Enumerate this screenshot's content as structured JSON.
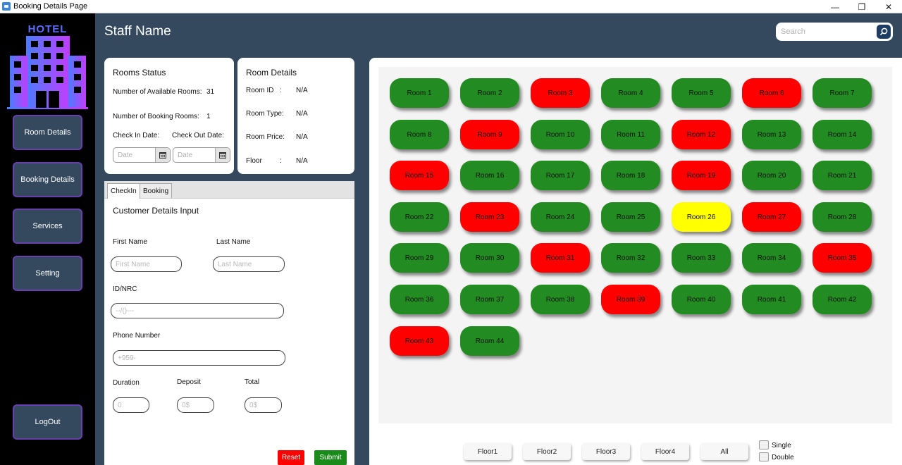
{
  "window": {
    "title": "Booking Details Page",
    "minimize": "—",
    "maximize": "❐",
    "close": "✕"
  },
  "sidebar": {
    "logo_text": "HOTEL",
    "items": [
      {
        "label": "Room Details"
      },
      {
        "label": "Booking Details"
      },
      {
        "label": "Services"
      },
      {
        "label": "Setting"
      }
    ],
    "logout": "LogOut"
  },
  "header": {
    "staff_name": "Staff Name",
    "search_placeholder": "Search"
  },
  "rooms_status": {
    "title": "Rooms Status",
    "available_label": "Number of Available Rooms:",
    "available_value": "31",
    "booking_label": "Number of Booking Rooms:",
    "booking_value": "1",
    "checkin_label": "Check In Date:",
    "checkout_label": "Check Out Date:",
    "date_placeholder": "Date"
  },
  "room_details": {
    "title": "Room Details",
    "fields": [
      {
        "label": "Room ID",
        "sep": ":",
        "value": "N/A"
      },
      {
        "label": "Room Type:",
        "sep": "",
        "value": "N/A"
      },
      {
        "label": "Room Price:",
        "sep": "",
        "value": "N/A"
      },
      {
        "label": "Floor",
        "sep": ":",
        "value": "N/A"
      }
    ]
  },
  "form": {
    "tabs": [
      "CheckIn",
      "Booking"
    ],
    "title": "Customer Details Input",
    "first_name_label": "First Name",
    "first_name_placeholder": "First Name",
    "last_name_label": "Last Name",
    "last_name_placeholder": "Last Name",
    "id_label": "ID/NRC",
    "id_placeholder": "--/()---",
    "phone_label": "Phone Number",
    "phone_placeholder": "+959-",
    "duration_label": "Duration",
    "duration_placeholder": "0",
    "deposit_label": "Deposit",
    "deposit_placeholder": "0$",
    "total_label": "Total",
    "total_placeholder": "0$",
    "reset": "Reset",
    "submit": "Submit"
  },
  "colors": {
    "available": "#228b22",
    "booked": "#ff0000",
    "selected": "#ffff00"
  },
  "rooms": [
    {
      "label": "Room 1",
      "status": "available"
    },
    {
      "label": "Room 2",
      "status": "available"
    },
    {
      "label": "Room 3",
      "status": "booked"
    },
    {
      "label": "Room 4",
      "status": "available"
    },
    {
      "label": "Room 5",
      "status": "available"
    },
    {
      "label": "Room 6",
      "status": "booked"
    },
    {
      "label": "Room 7",
      "status": "available"
    },
    {
      "label": "Room 8",
      "status": "available"
    },
    {
      "label": "Room 9",
      "status": "booked"
    },
    {
      "label": "Room 10",
      "status": "available"
    },
    {
      "label": "Room 11",
      "status": "available"
    },
    {
      "label": "Room 12",
      "status": "booked"
    },
    {
      "label": "Room 13",
      "status": "available"
    },
    {
      "label": "Room 14",
      "status": "available"
    },
    {
      "label": "Room 15",
      "status": "booked"
    },
    {
      "label": "Room 16",
      "status": "available"
    },
    {
      "label": "Room 17",
      "status": "available"
    },
    {
      "label": "Room 18",
      "status": "available"
    },
    {
      "label": "Room 19",
      "status": "booked"
    },
    {
      "label": "Room 20",
      "status": "available"
    },
    {
      "label": "Room 21",
      "status": "available"
    },
    {
      "label": "Room 22",
      "status": "available"
    },
    {
      "label": "Room 23",
      "status": "booked"
    },
    {
      "label": "Room 24",
      "status": "available"
    },
    {
      "label": "Room 25",
      "status": "available"
    },
    {
      "label": "Room 26",
      "status": "selected"
    },
    {
      "label": "Room 27",
      "status": "booked"
    },
    {
      "label": "Room 28",
      "status": "available"
    },
    {
      "label": "Room 29",
      "status": "available"
    },
    {
      "label": "Room 30",
      "status": "available"
    },
    {
      "label": "Room 31",
      "status": "booked"
    },
    {
      "label": "Room 32",
      "status": "available"
    },
    {
      "label": "Room 33",
      "status": "available"
    },
    {
      "label": "Room 34",
      "status": "available"
    },
    {
      "label": "Room 35",
      "status": "booked"
    },
    {
      "label": "Room 36",
      "status": "available"
    },
    {
      "label": "Room 37",
      "status": "available"
    },
    {
      "label": "Room 38",
      "status": "available"
    },
    {
      "label": "Room 39",
      "status": "booked"
    },
    {
      "label": "Room 40",
      "status": "available"
    },
    {
      "label": "Room 41",
      "status": "available"
    },
    {
      "label": "Room 42",
      "status": "available"
    },
    {
      "label": "Room 43",
      "status": "booked"
    },
    {
      "label": "Room 44",
      "status": "available"
    }
  ],
  "floors": [
    "Floor1",
    "Floor2",
    "Floor3",
    "Floor4",
    "All"
  ],
  "filters": [
    {
      "label": "Single",
      "checked": false
    },
    {
      "label": "Double",
      "checked": false
    }
  ]
}
